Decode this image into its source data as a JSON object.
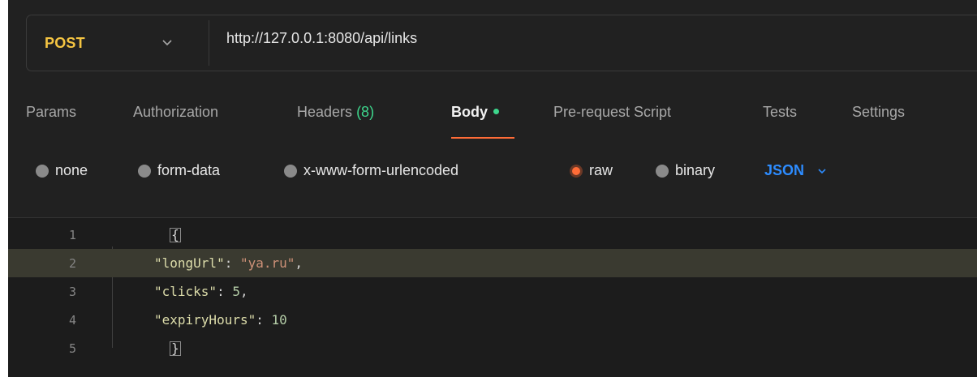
{
  "request": {
    "method": "POST",
    "url": "http://127.0.0.1:8080/api/links"
  },
  "tabs": [
    {
      "label": "Params"
    },
    {
      "label": "Authorization"
    },
    {
      "label": "Headers",
      "count": "(8)"
    },
    {
      "label": "Body"
    },
    {
      "label": "Pre-request Script"
    },
    {
      "label": "Tests"
    },
    {
      "label": "Settings"
    }
  ],
  "body_types": [
    {
      "label": "none"
    },
    {
      "label": "form-data"
    },
    {
      "label": "x-www-form-urlencoded"
    },
    {
      "label": "raw"
    },
    {
      "label": "binary"
    }
  ],
  "format": "JSON",
  "editor": {
    "lines": [
      {
        "no": "1",
        "open_brace": "{"
      },
      {
        "no": "2",
        "key": "\"longUrl\"",
        "sep": ": ",
        "value": "\"ya.ru\"",
        "trail": ","
      },
      {
        "no": "3",
        "key": "\"clicks\"",
        "sep": ": ",
        "value": "5",
        "trail": ","
      },
      {
        "no": "4",
        "key": "\"expiryHours\"",
        "sep": ": ",
        "value": "10",
        "trail": ""
      },
      {
        "no": "5",
        "close_brace": "}"
      }
    ]
  },
  "colors": {
    "method": "#f5c542",
    "accent": "#ff6c37",
    "active_dot": "#3dd68c",
    "json_format": "#2d8cff"
  }
}
